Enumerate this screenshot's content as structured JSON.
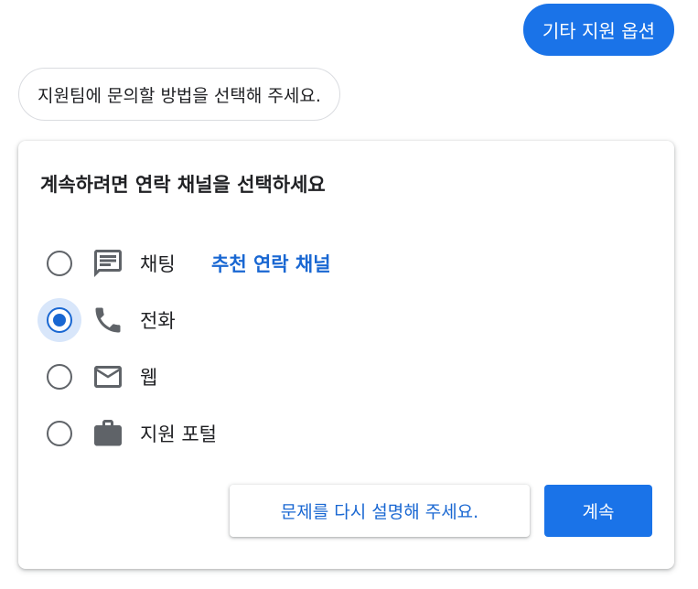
{
  "conversation": {
    "user_message": "기타 지원 옵션",
    "bot_message": "지원팀에 문의할 방법을 선택해 주세요."
  },
  "card": {
    "title": "계속하려면 연락 채널을 선택하세요",
    "options": [
      {
        "label": "채팅",
        "icon": "chat-icon",
        "badge": "추천 연락 채널",
        "selected": false
      },
      {
        "label": "전화",
        "icon": "phone-icon",
        "selected": true
      },
      {
        "label": "웹",
        "icon": "mail-icon",
        "selected": false
      },
      {
        "label": "지원 포털",
        "icon": "briefcase-icon",
        "selected": false
      }
    ],
    "secondary_button": "문제를 다시 설명해 주세요.",
    "primary_button": "계속"
  },
  "colors": {
    "accent": "#1a73e8",
    "accent_dark": "#1967d2",
    "icon_gray": "#5f6368",
    "text": "#202124"
  }
}
